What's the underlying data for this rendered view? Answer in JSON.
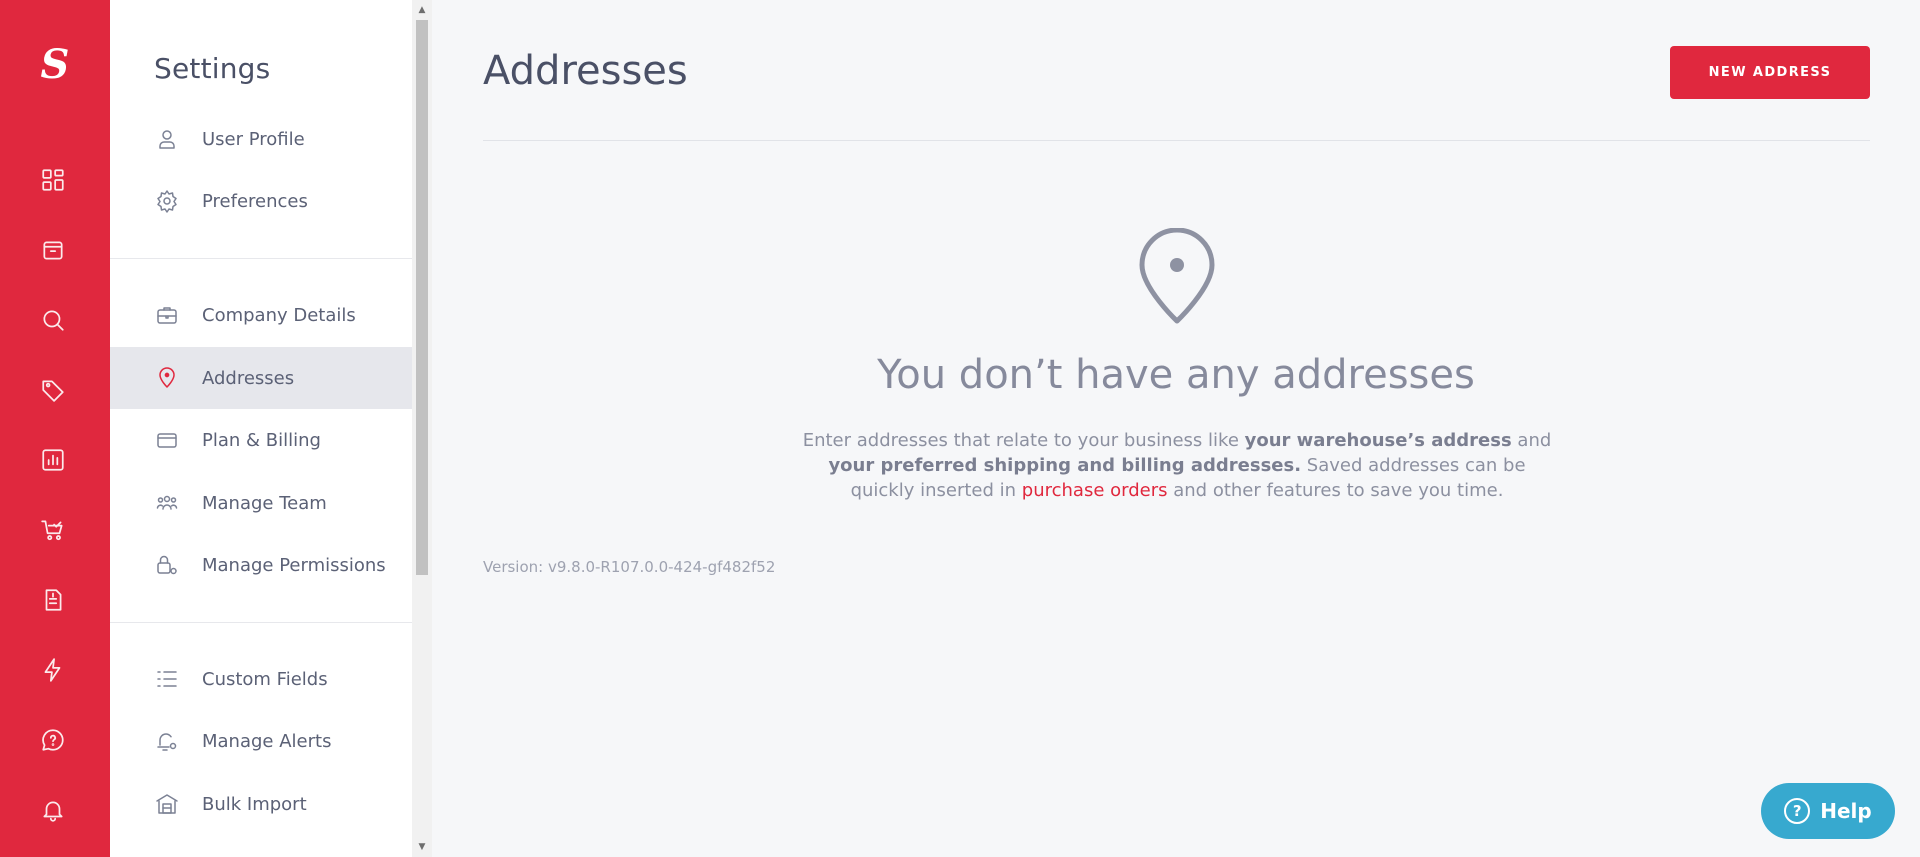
{
  "app": {
    "logo": "S"
  },
  "rail": {
    "icons": [
      "dashboard-icon",
      "inventory-box-icon",
      "search-icon",
      "tag-icon",
      "reports-chart-icon",
      "cart-check-icon",
      "invoice-icon",
      "bolt-icon",
      "help-chat-icon",
      "bell-icon"
    ]
  },
  "settings": {
    "title": "Settings",
    "items": [
      {
        "label": "User Profile",
        "icon": "user-icon"
      },
      {
        "label": "Preferences",
        "icon": "gear-icon"
      },
      {
        "label": "Company Details",
        "icon": "briefcase-icon"
      },
      {
        "label": "Addresses",
        "icon": "map-pin-icon",
        "active": true
      },
      {
        "label": "Plan & Billing",
        "icon": "credit-card-icon"
      },
      {
        "label": "Manage Team",
        "icon": "team-icon"
      },
      {
        "label": "Manage Permissions",
        "icon": "lock-gear-icon"
      },
      {
        "label": "Custom Fields",
        "icon": "list-icon"
      },
      {
        "label": "Manage Alerts",
        "icon": "bell-gear-icon"
      },
      {
        "label": "Bulk Import",
        "icon": "warehouse-icon"
      }
    ]
  },
  "main": {
    "title": "Addresses",
    "new_button": "NEW ADDRESS",
    "empty": {
      "icon": "map-pin-icon",
      "title": "You don’t have any addresses",
      "desc_1": "Enter addresses that relate to your business like ",
      "desc_bold_1": "your warehouse’s address",
      "desc_2": " and ",
      "desc_bold_2": "your preferred shipping and billing addresses.",
      "desc_3": " Saved addresses can be quickly inserted in ",
      "desc_link": "purchase orders",
      "desc_4": " and other features to save you time."
    },
    "version": "Version: v9.8.0-R107.0.0-424-gf482f52"
  },
  "help": {
    "label": "Help",
    "icon": "question-circle-icon"
  },
  "colors": {
    "brand": "#e0283e",
    "help": "#37a9cf",
    "active_bg": "#e6e7ec"
  }
}
